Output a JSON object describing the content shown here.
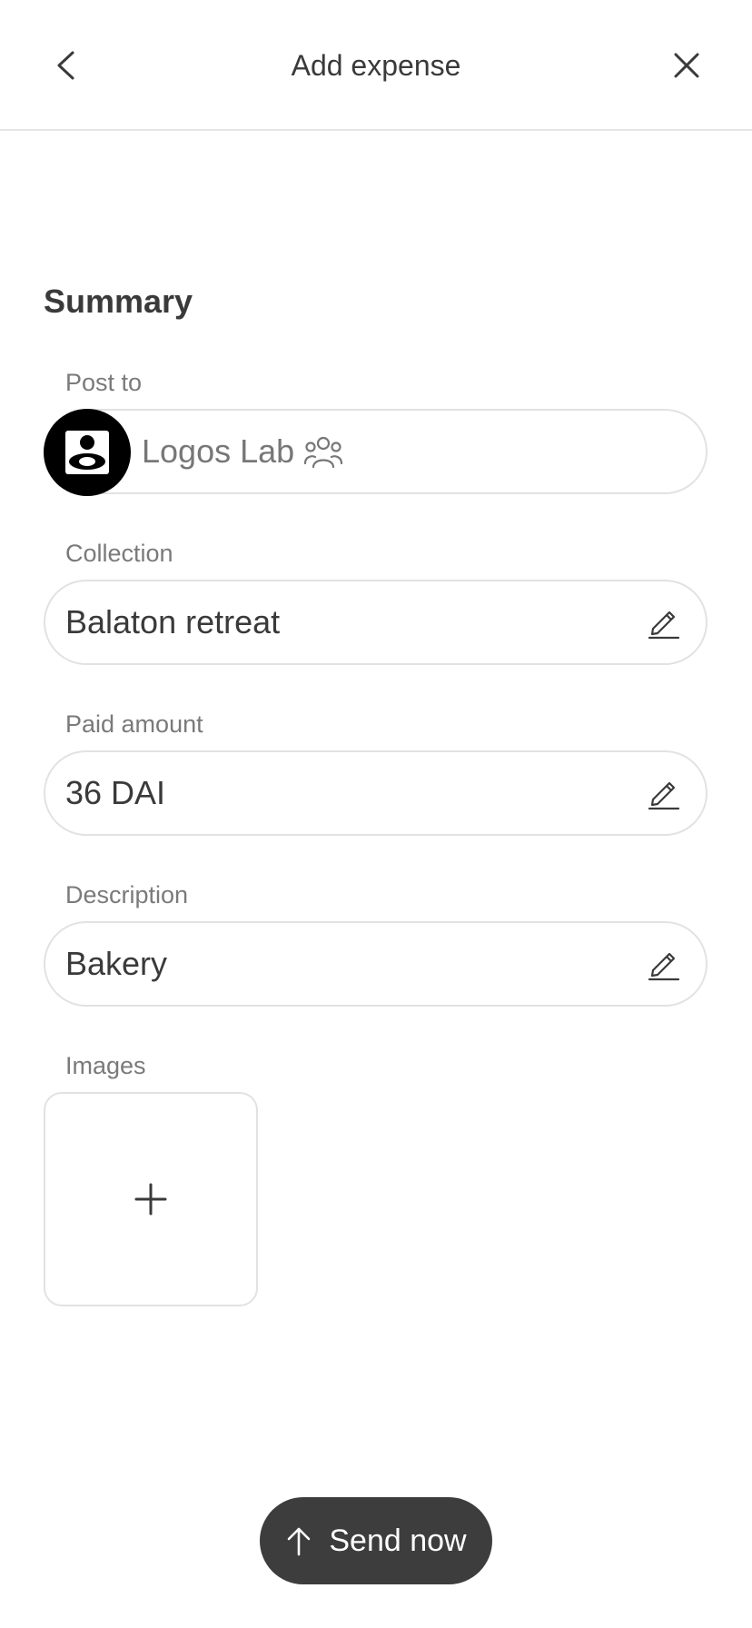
{
  "header": {
    "title": "Add expense",
    "back_icon": "chevron-left-icon",
    "close_icon": "close-icon"
  },
  "summary": {
    "title": "Summary",
    "post_to": {
      "label": "Post to",
      "value": "Logos Lab",
      "avatar_icon": "logos-lab-logo",
      "group_icon": "group-icon"
    },
    "collection": {
      "label": "Collection",
      "value": "Balaton retreat",
      "edit_icon": "pencil-icon"
    },
    "paid_amount": {
      "label": "Paid amount",
      "value": "36 DAI",
      "edit_icon": "pencil-icon"
    },
    "description": {
      "label": "Description",
      "value": "Bakery",
      "edit_icon": "pencil-icon"
    },
    "images": {
      "label": "Images",
      "add_icon": "plus-icon"
    }
  },
  "footer": {
    "send_label": "Send now",
    "send_icon": "arrow-up-icon",
    "button_color": "#3d3d3d"
  }
}
